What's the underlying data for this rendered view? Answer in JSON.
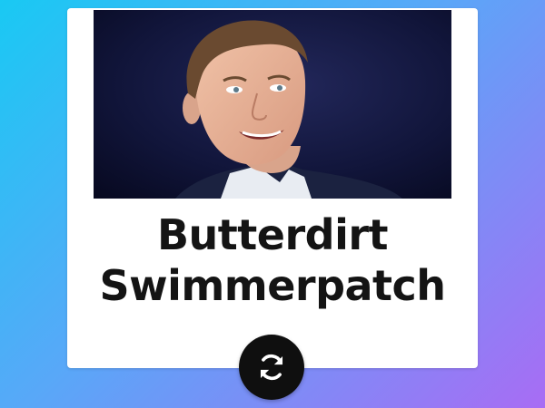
{
  "card": {
    "name_line_1": "Butterdirt",
    "name_line_2": "Swimmerpatch",
    "photo_alt": "Portrait photo of a smiling man in a dark suit against a dark blue background"
  },
  "controls": {
    "refresh_icon": "refresh-icon"
  },
  "colors": {
    "background_start": "#19c9f3",
    "background_end": "#a86cf4",
    "card": "#ffffff",
    "button": "#0f0f0f"
  }
}
